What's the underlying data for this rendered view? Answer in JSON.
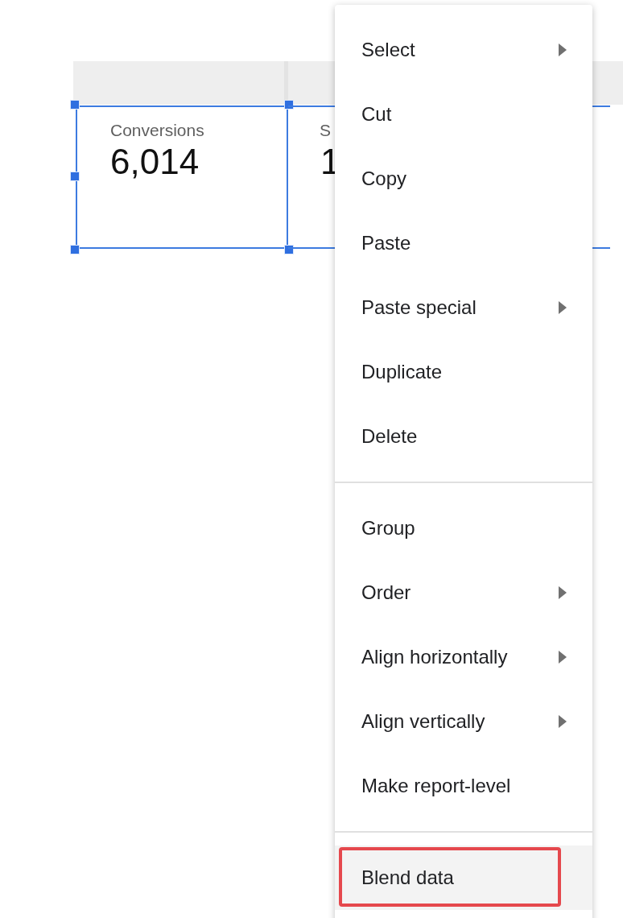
{
  "canvas": {
    "header_band": true,
    "scorecards": [
      {
        "label": "Conversions",
        "value": "6,014",
        "selected": true
      },
      {
        "label": "S",
        "value": "1",
        "selected": false
      }
    ]
  },
  "context_menu": {
    "sections": [
      {
        "items": [
          {
            "label": "Select",
            "has_submenu": true,
            "highlighted": false,
            "outlined": false
          },
          {
            "label": "Cut",
            "has_submenu": false,
            "highlighted": false,
            "outlined": false
          },
          {
            "label": "Copy",
            "has_submenu": false,
            "highlighted": false,
            "outlined": false
          },
          {
            "label": "Paste",
            "has_submenu": false,
            "highlighted": false,
            "outlined": false
          },
          {
            "label": "Paste special",
            "has_submenu": true,
            "highlighted": false,
            "outlined": false
          },
          {
            "label": "Duplicate",
            "has_submenu": false,
            "highlighted": false,
            "outlined": false
          },
          {
            "label": "Delete",
            "has_submenu": false,
            "highlighted": false,
            "outlined": false
          }
        ]
      },
      {
        "items": [
          {
            "label": "Group",
            "has_submenu": false,
            "highlighted": false,
            "outlined": false
          },
          {
            "label": "Order",
            "has_submenu": true,
            "highlighted": false,
            "outlined": false
          },
          {
            "label": "Align horizontally",
            "has_submenu": true,
            "highlighted": false,
            "outlined": false
          },
          {
            "label": "Align vertically",
            "has_submenu": true,
            "highlighted": false,
            "outlined": false
          },
          {
            "label": "Make report-level",
            "has_submenu": false,
            "highlighted": false,
            "outlined": false
          }
        ]
      },
      {
        "items": [
          {
            "label": "Blend data",
            "has_submenu": false,
            "highlighted": true,
            "outlined": true
          }
        ]
      }
    ]
  }
}
